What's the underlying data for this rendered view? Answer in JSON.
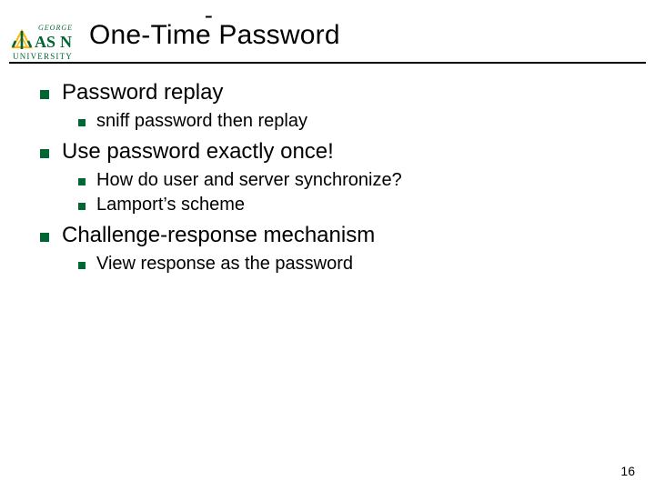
{
  "logo": {
    "line1": "GEORGE",
    "line2_a": "AS",
    "line2_b": "N",
    "sub": "UNIVERSITY"
  },
  "stray": "-",
  "title": "One-Time Password",
  "bullets": [
    {
      "text": "Password replay",
      "children": [
        {
          "text": "sniff password then replay"
        }
      ]
    },
    {
      "text": "Use password exactly once!",
      "children": [
        {
          "text": "How do user and server synchronize?"
        },
        {
          "text": "Lamport’s scheme"
        }
      ]
    },
    {
      "text": "Challenge-response mechanism",
      "children": [
        {
          "text": "View response as the password"
        }
      ]
    }
  ],
  "slide_number": "16"
}
